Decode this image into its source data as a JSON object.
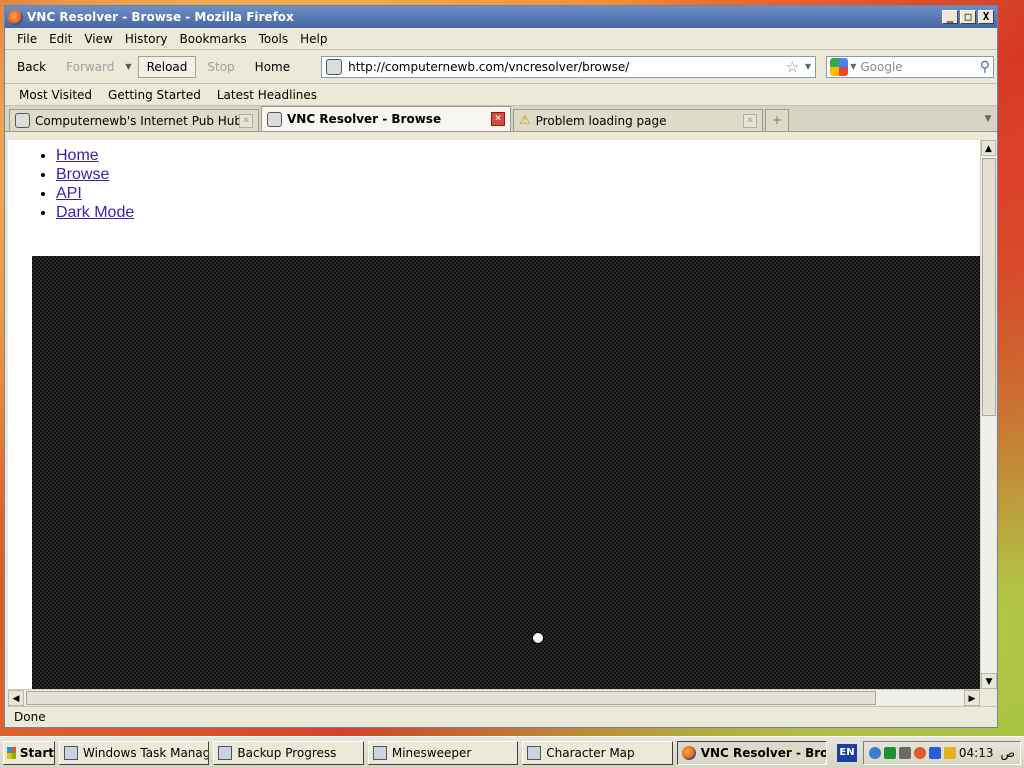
{
  "window": {
    "title": "VNC Resolver - Browse - Mozilla Firefox",
    "controls": {
      "minimize": "_",
      "maximize": "□",
      "close": "X"
    }
  },
  "menubar": [
    "File",
    "Edit",
    "View",
    "History",
    "Bookmarks",
    "Tools",
    "Help"
  ],
  "navbar": {
    "back": "Back",
    "forward": "Forward",
    "reload": "Reload",
    "stop": "Stop",
    "home": "Home",
    "url": "http://computernewb.com/vncresolver/browse/",
    "search_placeholder": "Google"
  },
  "bookmarks": [
    "Most Visited",
    "Getting Started",
    "Latest Headlines"
  ],
  "tabs": [
    {
      "label": "Computernewb's Internet Pub Hub",
      "active": false,
      "icon": "site-icon"
    },
    {
      "label": "VNC Resolver - Browse",
      "active": true,
      "icon": "site-icon"
    },
    {
      "label": "Problem loading page",
      "active": false,
      "icon": "warning-icon"
    }
  ],
  "page": {
    "links": [
      "Home",
      "Browse",
      "API",
      "Dark Mode"
    ]
  },
  "status": "Done",
  "taskbar": {
    "start": "Start",
    "tasks": [
      {
        "label": "Windows Task Manager",
        "active": false
      },
      {
        "label": "Backup Progress",
        "active": false
      },
      {
        "label": "Minesweeper",
        "active": false
      },
      {
        "label": "Character Map",
        "active": false
      },
      {
        "label": "VNC Resolver - Brow...",
        "active": true
      }
    ],
    "language": "EN",
    "clock": "04:13",
    "clock_suffix": "ص"
  },
  "colors": {
    "link": "#3b22a8",
    "titlebar": "#4565a3",
    "vnc_pattern": "#0e0e0e"
  }
}
